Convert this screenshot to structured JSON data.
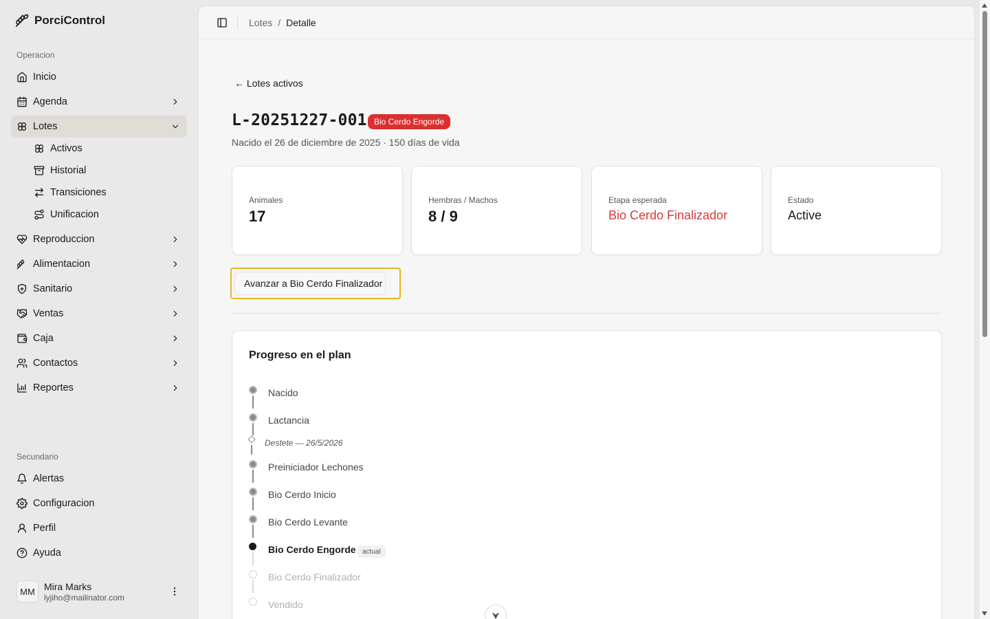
{
  "app": {
    "name": "PorciControl"
  },
  "sidebar": {
    "section_primary": "Operacion",
    "items": [
      {
        "label": "Inicio",
        "icon": "home-icon"
      },
      {
        "label": "Agenda",
        "icon": "calendar-icon"
      },
      {
        "label": "Lotes",
        "icon": "lots-icon",
        "expanded": true
      },
      {
        "label": "Reproduccion",
        "icon": "heart-pulse-icon"
      },
      {
        "label": "Alimentacion",
        "icon": "wheat-icon"
      },
      {
        "label": "Sanitario",
        "icon": "shield-plus-icon"
      },
      {
        "label": "Ventas",
        "icon": "handshake-icon"
      },
      {
        "label": "Caja",
        "icon": "wallet-icon"
      },
      {
        "label": "Contactos",
        "icon": "users-icon"
      },
      {
        "label": "Reportes",
        "icon": "bar-chart-icon"
      }
    ],
    "lotes_sub": [
      {
        "label": "Activos",
        "icon": "lots-icon"
      },
      {
        "label": "Historial",
        "icon": "archive-icon"
      },
      {
        "label": "Transiciones",
        "icon": "swap-icon"
      },
      {
        "label": "Unificacion",
        "icon": "merge-icon"
      }
    ],
    "section_secondary": "Secundario",
    "secondary": [
      {
        "label": "Alertas",
        "icon": "bell-icon"
      },
      {
        "label": "Configuracion",
        "icon": "gear-icon"
      },
      {
        "label": "Perfil",
        "icon": "user-icon"
      },
      {
        "label": "Ayuda",
        "icon": "help-icon"
      }
    ],
    "user": {
      "initials": "MM",
      "name": "Mira Marks",
      "email": "lyjiho@mailinator.com"
    }
  },
  "breadcrumb": {
    "parent": "Lotes",
    "separator": "/",
    "current": "Detalle"
  },
  "page": {
    "back_link": "← Lotes activos",
    "lote_id": "L-20251227-001",
    "stage_badge": "Bio Cerdo Engorde",
    "subtitle": "Nacido el 26 de diciembre de 2025 · 150 días de vida",
    "stats": [
      {
        "label": "Animales",
        "value": "17"
      },
      {
        "label": "Hembras / Machos",
        "value": "8 / 9"
      },
      {
        "label": "Etapa esperada",
        "value": "Bio Cerdo Finalizador"
      },
      {
        "label": "Estado",
        "value": "Active"
      }
    ],
    "advance_button": "Avanzar a Bio Cerdo Finalizador"
  },
  "plan": {
    "title": "Progreso en el plan",
    "stages": [
      {
        "label": "Nacido",
        "status": "done"
      },
      {
        "label": "Lactancia",
        "status": "done"
      },
      {
        "label": "Preiniciador Lechones",
        "status": "done"
      },
      {
        "label": "Bio Cerdo Inicio",
        "status": "done"
      },
      {
        "label": "Bio Cerdo Levante",
        "status": "done"
      },
      {
        "label": "Bio Cerdo Engorde",
        "status": "current"
      },
      {
        "label": "Bio Cerdo Finalizador",
        "status": "future"
      },
      {
        "label": "Vendido",
        "status": "future"
      }
    ],
    "event": "Destete — 26/5/2026",
    "current_badge": "actual"
  },
  "colors": {
    "accent_red": "#dc2f2f",
    "highlight": "#e8b622",
    "sidebar_bg": "#e9e9e9",
    "active_item": "#e0ddd6"
  }
}
